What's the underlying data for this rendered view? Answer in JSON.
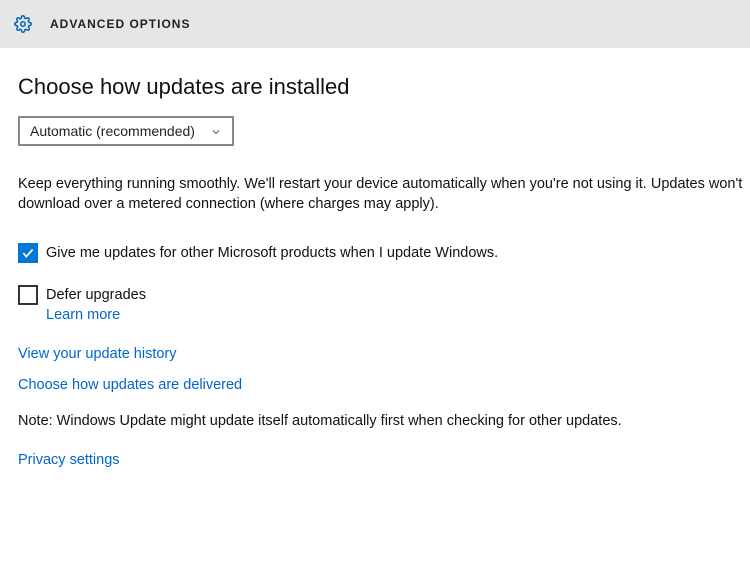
{
  "header": {
    "title": "ADVANCED OPTIONS"
  },
  "main": {
    "heading": "Choose how updates are installed",
    "dropdown": {
      "selected": "Automatic (recommended)"
    },
    "description_line1": "Keep everything running smoothly. We'll restart your device automatically when you're not using it. Updates won't",
    "description_line2": "download over a metered connection (where charges may apply).",
    "checkbox1": {
      "checked": true,
      "label": "Give me updates for other Microsoft products when I update Windows."
    },
    "checkbox2": {
      "checked": false,
      "label": "Defer upgrades",
      "learn_more": "Learn more"
    },
    "links": {
      "history": "View your update history",
      "delivered": "Choose how updates are delivered",
      "privacy": "Privacy settings"
    },
    "note": "Note: Windows Update might update itself automatically first when checking for other updates."
  }
}
